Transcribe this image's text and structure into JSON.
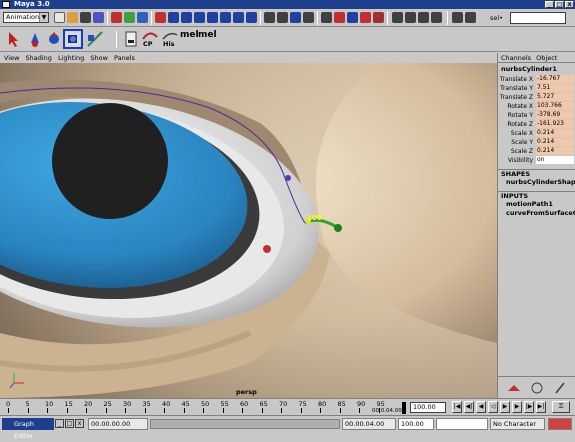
{
  "window": {
    "title": "Maya 3.0"
  },
  "statusline": {
    "menu_set": "Animation",
    "sel_label": "sel•"
  },
  "shelf": {
    "cp_label": "CP",
    "his_label": "His",
    "mel1_label": "mel",
    "mel2_label": "mel"
  },
  "view_menu": [
    "View",
    "Shading",
    "Lighting",
    "Show",
    "Panels"
  ],
  "viewport": {
    "camera_label": "persp",
    "frame_label": "100"
  },
  "channel_box": {
    "tabs": [
      "Channels",
      "Object"
    ],
    "object_name": "nurbsCylinder1",
    "attributes": [
      {
        "label": "Translate X",
        "value": "-16.767"
      },
      {
        "label": "Translate Y",
        "value": "7.51"
      },
      {
        "label": "Translate Z",
        "value": "5.727"
      },
      {
        "label": "Rotate X",
        "value": "103.766"
      },
      {
        "label": "Rotate Y",
        "value": "-378.69"
      },
      {
        "label": "Rotate Z",
        "value": "-161.923"
      },
      {
        "label": "Scale X",
        "value": "0.214"
      },
      {
        "label": "Scale Y",
        "value": "0.214"
      },
      {
        "label": "Scale Z",
        "value": "0.214"
      },
      {
        "label": "Visibility",
        "value": "on"
      }
    ],
    "shapes_header": "SHAPES",
    "shape_name": "nurbsCylinderShape1",
    "inputs_header": "INPUTS",
    "inputs": [
      "motionPath1",
      "curveFromSurfaceCo"
    ]
  },
  "time_slider": {
    "ticks": [
      "0",
      "5",
      "10",
      "15",
      "20",
      "25",
      "30",
      "35",
      "40",
      "45",
      "50",
      "55",
      "60",
      "65",
      "70",
      "75",
      "80",
      "85",
      "90",
      "95"
    ],
    "current_frame_text": "00.0.04.00",
    "range_end_1": "100.00",
    "range_end_2": "100.00"
  },
  "bottom_bar": {
    "task_label": "Graph Editor",
    "time_left": "00.00.00.00",
    "time_right": "00.00.04.00",
    "character": "No Character"
  },
  "colors": {
    "titlebar": "#1e3f8c",
    "iris": "#2e86c0",
    "skin": "#d8c2a4",
    "curve": "#4a2a9a"
  }
}
